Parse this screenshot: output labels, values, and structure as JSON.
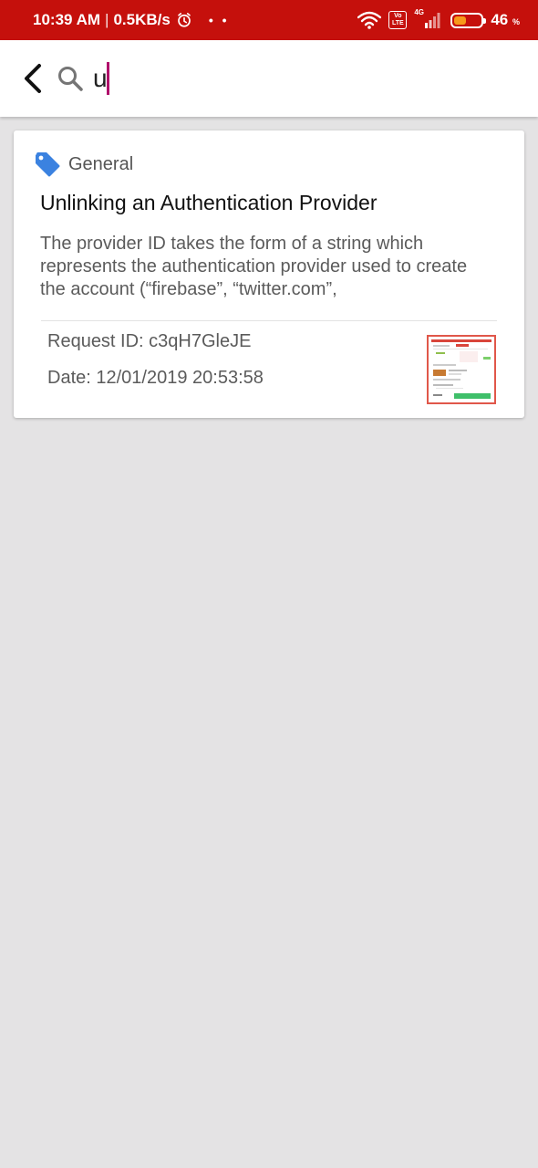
{
  "status_bar": {
    "time": "10:39 AM",
    "separator": "|",
    "speed": "0.5KB/s",
    "dots": "• •",
    "volte": "Vo LTE",
    "network": "4G",
    "battery_percent": "46",
    "battery_unit": "%",
    "battery_level": 0.46,
    "color": "#c5100c"
  },
  "search": {
    "query": "u"
  },
  "results": [
    {
      "category": "General",
      "category_icon": "tag-icon",
      "title": "Unlinking an Authentication Provider",
      "description": "The provider ID takes the form of a string which represents the authentication provider used to create the account (“firebase”, “twitter.com”,",
      "request_id": "Request ID: c3qH7GleJE",
      "date": "Date: 12/01/2019 20:53:58"
    }
  ],
  "colors": {
    "accent": "#c5100c",
    "tag": "#3b82e0",
    "caret": "#b0106b",
    "background": "#e4e3e4"
  }
}
